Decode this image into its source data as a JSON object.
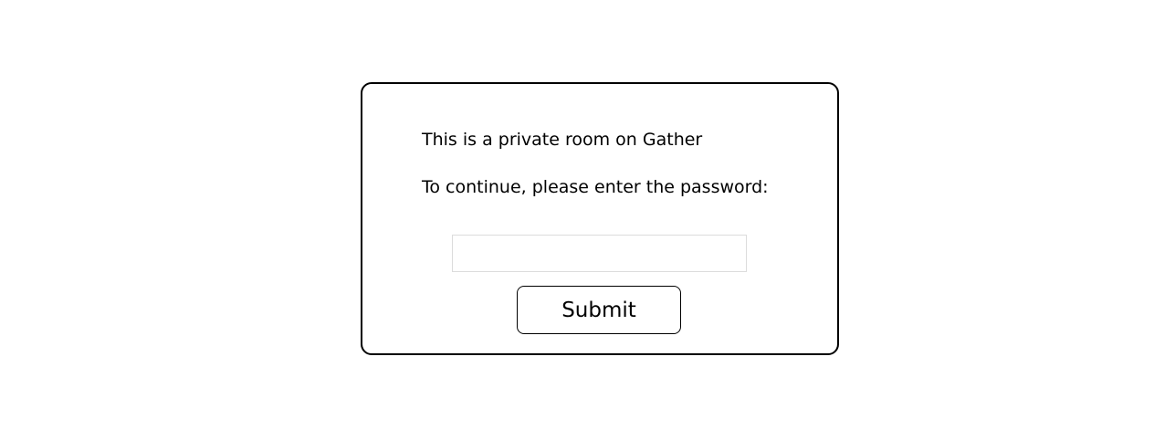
{
  "dialog": {
    "title": "This is a private room on Gather",
    "prompt": "To continue, please enter the password:",
    "password_field": {
      "value": "",
      "placeholder": ""
    },
    "submit_label": "Submit"
  }
}
